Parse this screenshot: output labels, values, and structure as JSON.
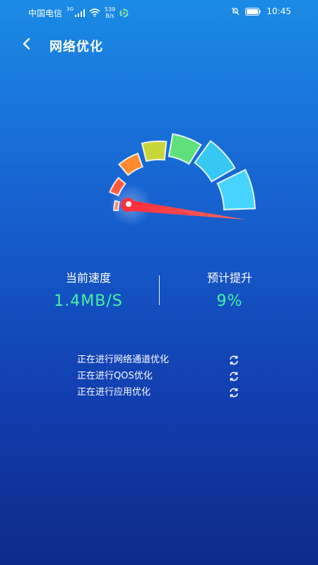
{
  "status_bar": {
    "carrier": "中国电信",
    "network_type": "3G",
    "net_speed_value": "539",
    "net_speed_unit": "B/s",
    "time": "10:45"
  },
  "header": {
    "title": "网络优化",
    "back_icon": "back-arrow-icon"
  },
  "gauge": {
    "level_fraction": 0.95,
    "segment_count": 7
  },
  "stats": {
    "current_speed_label": "当前速度",
    "current_speed_value": "1.4MB/S",
    "expected_boost_label": "预计提升",
    "expected_boost_value": "9%"
  },
  "tasks": [
    {
      "label": "正在进行网络通道优化",
      "icon": "sync-icon"
    },
    {
      "label": "正在进行QOS优化",
      "icon": "sync-icon"
    },
    {
      "label": "正在进行应用优化",
      "icon": "sync-icon"
    }
  ],
  "colors": {
    "value_green": "#47f0a8",
    "needle_red": "#ff2a3a"
  }
}
